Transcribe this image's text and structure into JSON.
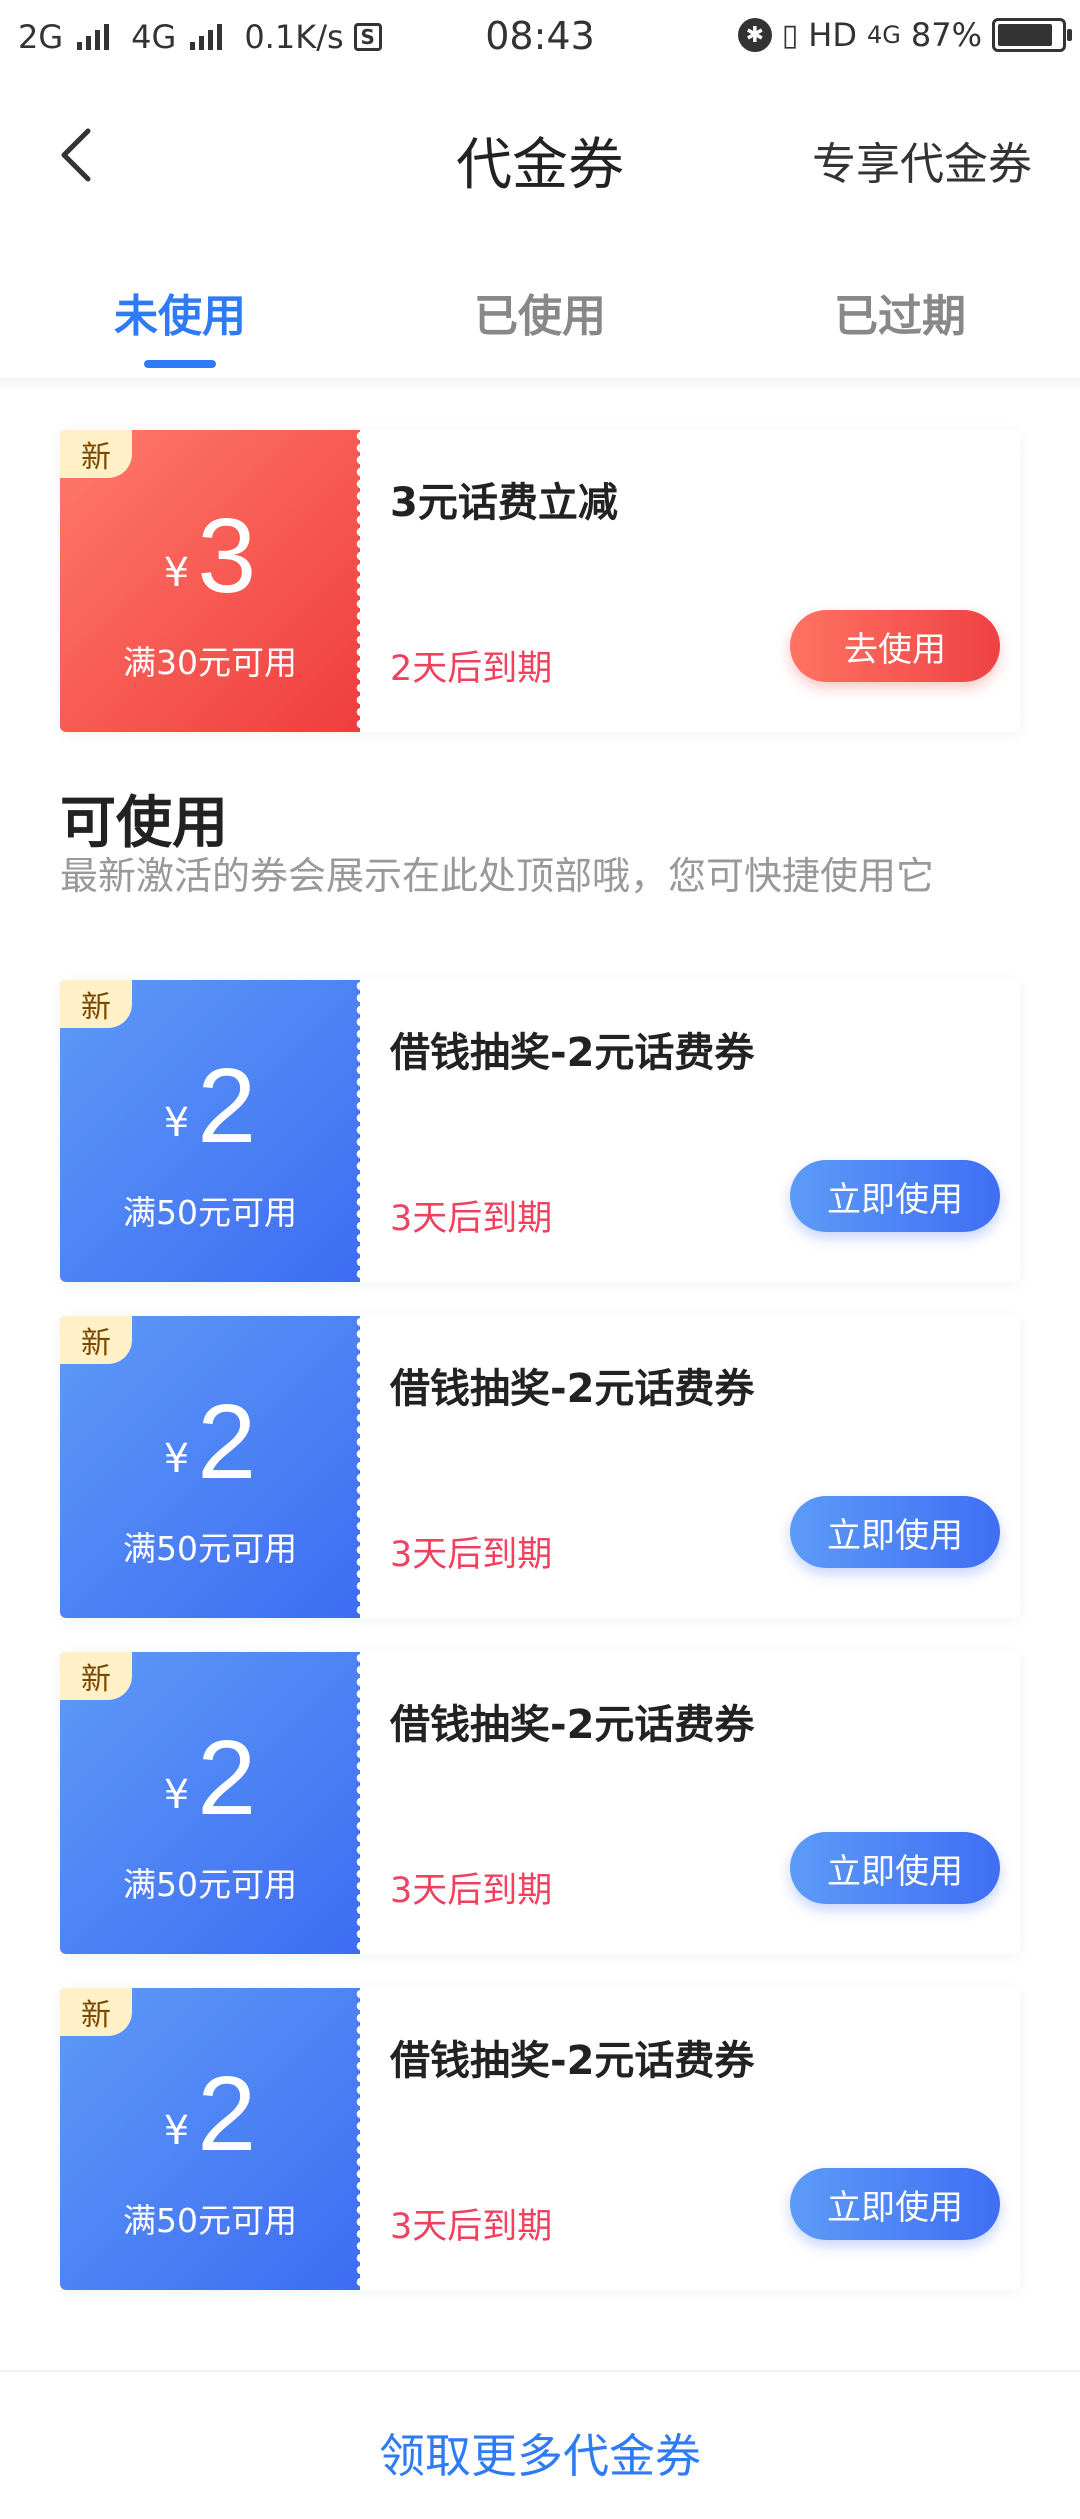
{
  "status_bar": {
    "net1": "2G",
    "net2": "4G",
    "speed": "0.1K/s",
    "s_icon": "S",
    "time": "08:43",
    "hd": "HD",
    "net3": "4G",
    "battery": "87%",
    "battery_level": 0.87
  },
  "nav": {
    "title": "代金券",
    "right_label": "专享代金券"
  },
  "tabs": [
    {
      "label": "未使用",
      "active": true
    },
    {
      "label": "已使用",
      "active": false
    },
    {
      "label": "已过期",
      "active": false
    }
  ],
  "featured": {
    "badge": "新",
    "currency": "¥",
    "amount": "3",
    "condition": "满30元可用",
    "title": "3元话费立减",
    "expiry": "2天后到期",
    "button": "去使用",
    "accent": "#ef3d3e"
  },
  "section": {
    "title": "可使用",
    "desc": "最新激活的券会展示在此处顶部哦，您可快捷使用它"
  },
  "coupons": [
    {
      "badge": "新",
      "currency": "¥",
      "amount": "2",
      "condition": "满50元可用",
      "title": "借钱抽奖-2元话费券",
      "expiry": "3天后到期",
      "button": "立即使用"
    },
    {
      "badge": "新",
      "currency": "¥",
      "amount": "2",
      "condition": "满50元可用",
      "title": "借钱抽奖-2元话费券",
      "expiry": "3天后到期",
      "button": "立即使用"
    },
    {
      "badge": "新",
      "currency": "¥",
      "amount": "2",
      "condition": "满50元可用",
      "title": "借钱抽奖-2元话费券",
      "expiry": "3天后到期",
      "button": "立即使用"
    },
    {
      "badge": "新",
      "currency": "¥",
      "amount": "2",
      "condition": "满50元可用",
      "title": "借钱抽奖-2元话费券",
      "expiry": "3天后到期",
      "button": "立即使用"
    }
  ],
  "bottom": {
    "link": "领取更多代金券"
  },
  "colors": {
    "primary_blue": "#2e7bf5",
    "expiry_red": "#f0415f"
  }
}
